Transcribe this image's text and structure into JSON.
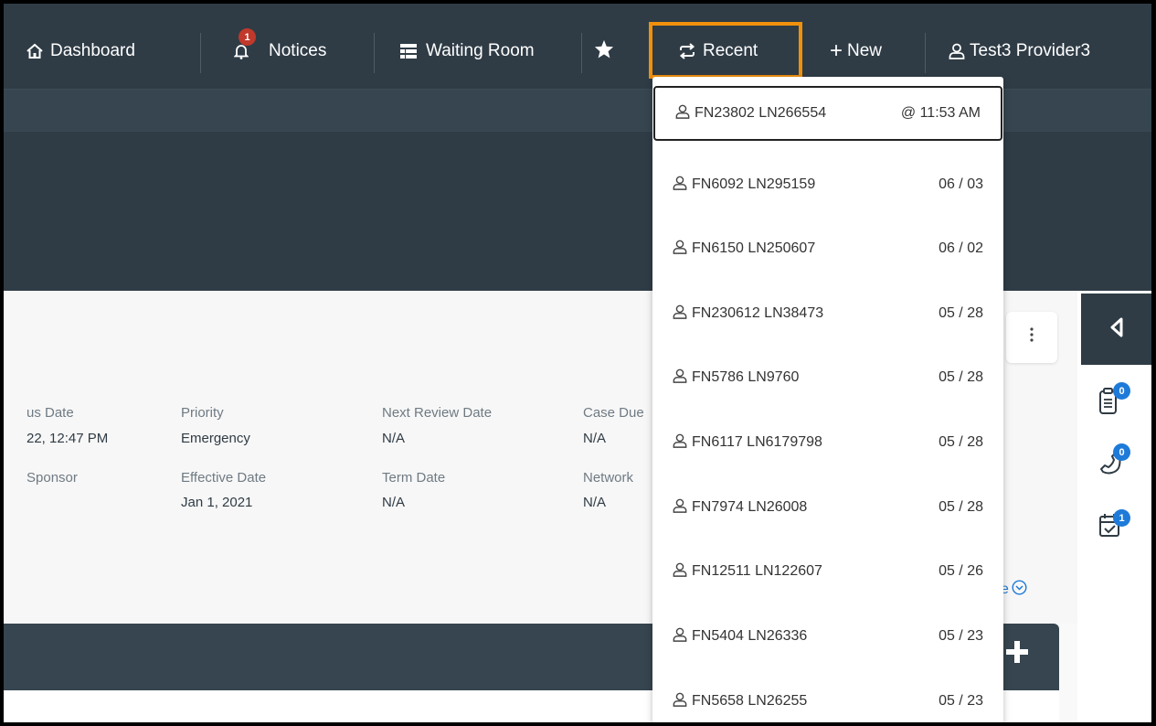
{
  "nav": {
    "dashboard_label": "Dashboard",
    "notices_label": "Notices",
    "notices_badge": "1",
    "waiting_room_label": "Waiting Room",
    "recent_label": "Recent",
    "new_label": "New",
    "user_label": "Test3 Provider3"
  },
  "case": {
    "status_date_label": "us Date",
    "status_date_value": "22, 12:47 PM",
    "sponsor_label": "Sponsor",
    "priority_label": "Priority",
    "priority_value": "Emergency",
    "effective_date_label": "Effective Date",
    "effective_date_value": "Jan 1, 2021",
    "next_review_label": "Next Review Date",
    "next_review_value": "N/A",
    "term_date_label": "Term Date",
    "term_date_value": "N/A",
    "case_due_label": "Case Due",
    "case_due_value": "N/A",
    "network_label": "Network",
    "network_value": "N/A",
    "more_link": "e"
  },
  "rail": {
    "notes_badge": "0",
    "calls_badge": "0",
    "tasks_badge": "1"
  },
  "recent": [
    {
      "name": "FN23802 LN266554",
      "time": "@ 11:53 AM"
    },
    {
      "name": "FN6092 LN295159",
      "time": "06 / 03"
    },
    {
      "name": "FN6150 LN250607",
      "time": "06 / 02"
    },
    {
      "name": "FN230612 LN38473",
      "time": "05 / 28"
    },
    {
      "name": "FN5786 LN9760",
      "time": "05 / 28"
    },
    {
      "name": "FN6117 LN6179798",
      "time": "05 / 28"
    },
    {
      "name": "FN7974 LN26008",
      "time": "05 / 28"
    },
    {
      "name": "FN12511 LN122607",
      "time": "05 / 26"
    },
    {
      "name": "FN5404 LN26336",
      "time": "05 / 23"
    },
    {
      "name": "FN5658 LN26255",
      "time": "05 / 23"
    }
  ],
  "colors": {
    "nav_bg": "#2f3c46",
    "highlight": "#f0900c",
    "badge_red": "#c0392b",
    "badge_blue": "#1e7ad9"
  }
}
